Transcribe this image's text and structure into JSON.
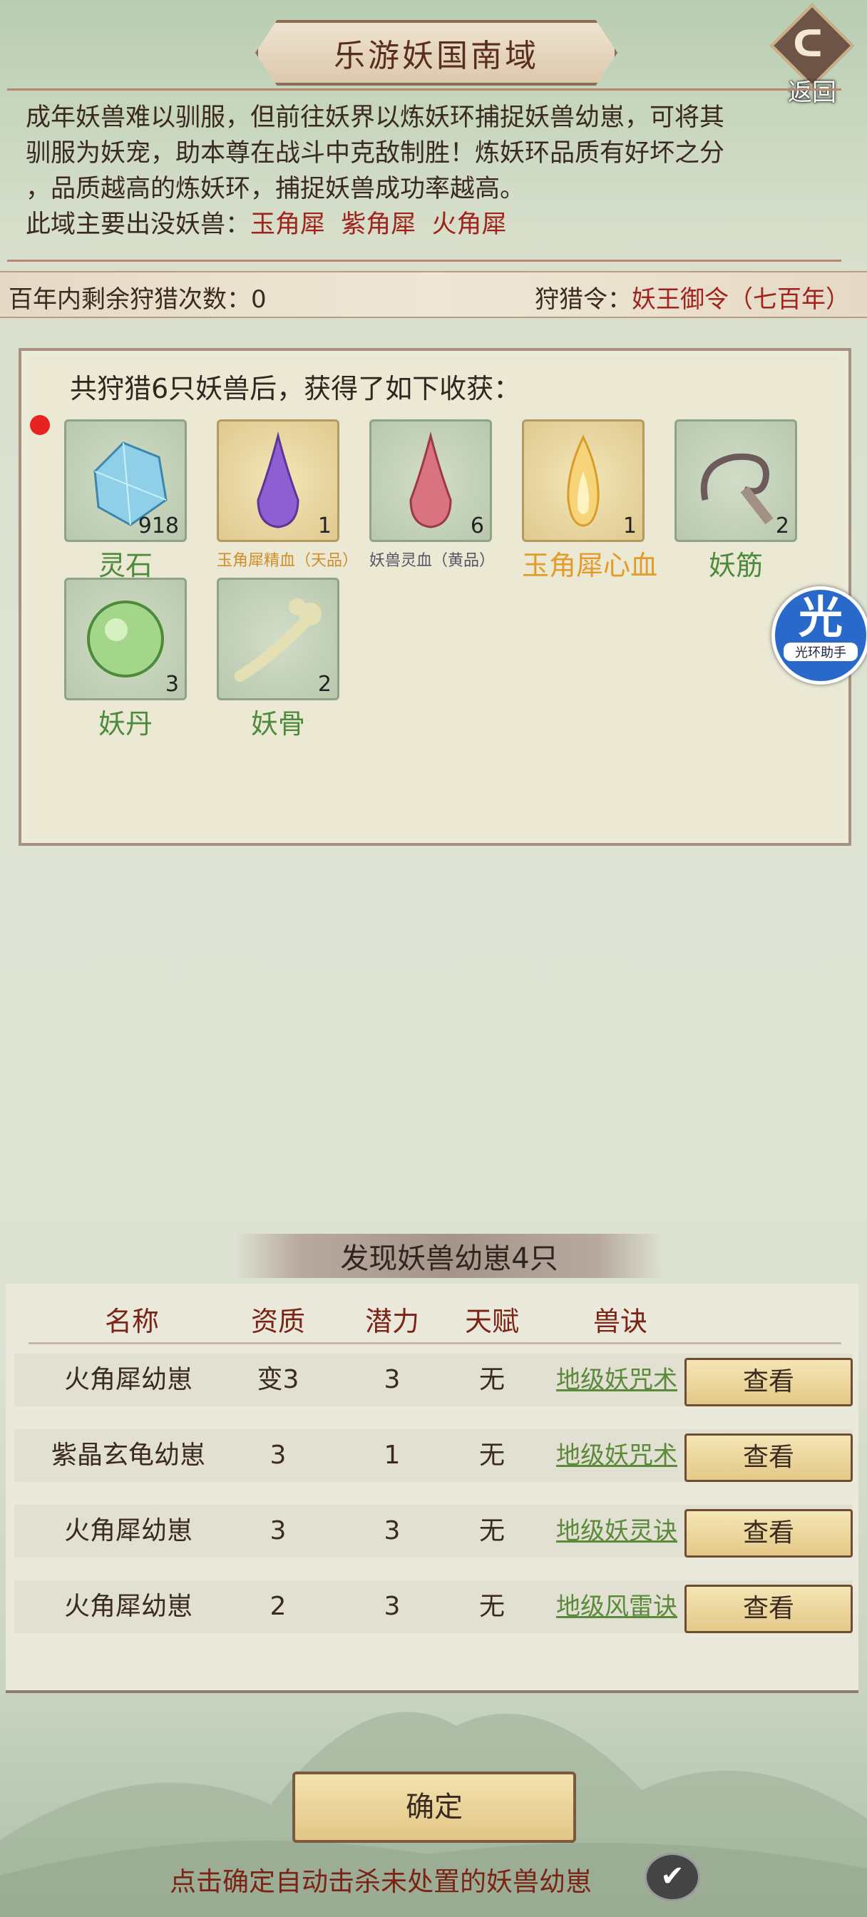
{
  "header": {
    "title": "乐游妖国南域",
    "back_label": "返回"
  },
  "description": {
    "line1": "成年妖兽难以驯服，但前往妖界以炼妖环捕捉妖兽幼崽，可将其",
    "line2": "驯服为妖宠，助本尊在战斗中克敌制胜！炼妖环品质有好坏之分",
    "line3": "，品质越高的炼妖环，捕捉妖兽成功率越高。",
    "line4_prefix": "此域主要出没妖兽：",
    "beasts": "玉角犀  紫角犀  火角犀"
  },
  "info": {
    "remaining_label": "百年内剩余狩猎次数：",
    "remaining_value": "0",
    "order_label": "狩猎令：",
    "order_value": "妖王御令（七百年）"
  },
  "harvest": {
    "title": "共狩猎6只妖兽后，获得了如下收获：",
    "items": [
      {
        "name": "灵石",
        "count": "918",
        "icon": "crystal-icon"
      },
      {
        "name": "玉角犀精血（天品）",
        "count": "1",
        "icon": "purple-drop-icon"
      },
      {
        "name": "妖兽灵血（黄品）",
        "count": "6",
        "icon": "red-drop-icon"
      },
      {
        "name": "玉角犀心血",
        "count": "1",
        "icon": "flame-icon"
      },
      {
        "name": "妖筋",
        "count": "2",
        "icon": "tendon-icon"
      },
      {
        "name": "妖丹",
        "count": "3",
        "icon": "orb-icon"
      },
      {
        "name": "妖骨",
        "count": "2",
        "icon": "bone-icon"
      }
    ]
  },
  "halo_badge": {
    "glyph": "光",
    "label": "光环助手"
  },
  "found": {
    "title": "发现妖兽幼崽4只",
    "headers": {
      "name": "名称",
      "aptitude": "资质",
      "potential": "潜力",
      "talent": "天赋",
      "skill": "兽诀"
    },
    "rows": [
      {
        "name": "火角犀幼崽",
        "aptitude": "变3",
        "potential": "3",
        "talent": "无",
        "skill": "地级妖咒术",
        "view": "查看"
      },
      {
        "name": "紫晶玄龟幼崽",
        "aptitude": "3",
        "potential": "1",
        "talent": "无",
        "skill": "地级妖咒术",
        "view": "查看"
      },
      {
        "name": "火角犀幼崽",
        "aptitude": "3",
        "potential": "3",
        "talent": "无",
        "skill": "地级妖灵诀",
        "view": "查看"
      },
      {
        "name": "火角犀幼崽",
        "aptitude": "2",
        "potential": "3",
        "talent": "无",
        "skill": "地级风雷诀",
        "view": "查看"
      }
    ]
  },
  "confirm_label": "确定",
  "footer_text": "点击确定自动击杀未处置的妖兽幼崽",
  "check_glyph": "✔"
}
